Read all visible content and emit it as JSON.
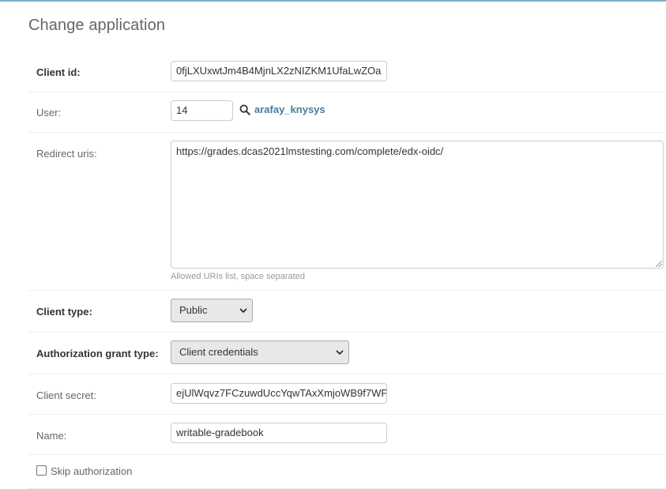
{
  "page": {
    "title": "Change application",
    "accent_color": "#79aec8",
    "link_color": "#447e9b"
  },
  "fields": {
    "client_id": {
      "label": "Client id:",
      "value": "0fjLXUxwtJm4B4MjnLX2zNIZKM1UfaLwZOa"
    },
    "user": {
      "label": "User:",
      "value": "14",
      "lookup_icon": "search-icon",
      "username": "arafay_knysys"
    },
    "redirect_uris": {
      "label": "Redirect uris:",
      "value": "https://grades.dcas2021lmstesting.com/complete/edx-oidc/",
      "help_text": "Allowed URIs list, space separated"
    },
    "client_type": {
      "label": "Client type:",
      "selected": "Public"
    },
    "authorization_grant_type": {
      "label": "Authorization grant type:",
      "selected": "Client credentials"
    },
    "client_secret": {
      "label": "Client secret:",
      "value": "ejUlWqvz7FCzuwdUccYqwTAxXmjoWB9f7WF"
    },
    "name": {
      "label": "Name:",
      "value": "writable-gradebook"
    },
    "skip_authorization": {
      "label": "Skip authorization",
      "checked": false
    }
  }
}
